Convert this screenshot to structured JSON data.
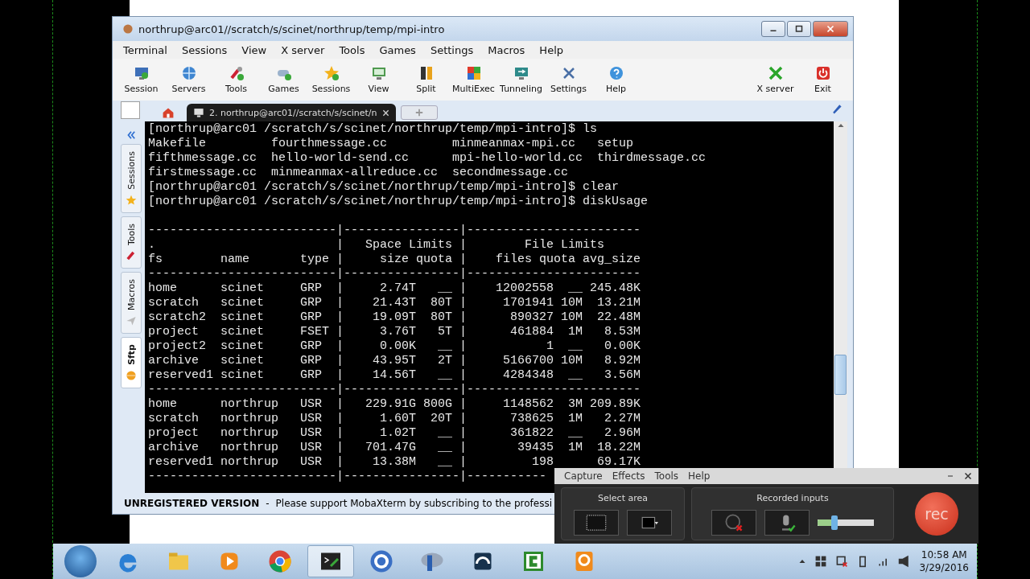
{
  "window": {
    "title": "northrup@arc01//scratch/s/scinet/northrup/temp/mpi-intro"
  },
  "menu": [
    "Terminal",
    "Sessions",
    "View",
    "X server",
    "Tools",
    "Games",
    "Settings",
    "Macros",
    "Help"
  ],
  "toolbar": {
    "left": [
      {
        "label": "Session"
      },
      {
        "label": "Servers"
      },
      {
        "label": "Tools"
      },
      {
        "label": "Games"
      },
      {
        "label": "Sessions"
      },
      {
        "label": "View"
      },
      {
        "label": "Split"
      },
      {
        "label": "MultiExec"
      },
      {
        "label": "Tunneling"
      },
      {
        "label": "Settings"
      },
      {
        "label": "Help"
      }
    ],
    "right": [
      {
        "label": "X server"
      },
      {
        "label": "Exit"
      }
    ]
  },
  "tabs": [
    {
      "kind": "home",
      "selected": false
    },
    {
      "kind": "session",
      "label": "2. northrup@arc01//scratch/s/scinet/n",
      "selected": true
    }
  ],
  "side_tabs": [
    {
      "label": "Sessions",
      "selected": false
    },
    {
      "label": "Tools",
      "selected": false
    },
    {
      "label": "Macros",
      "selected": false
    },
    {
      "label": "Sftp",
      "selected": true
    }
  ],
  "terminal": {
    "lines": [
      "[northrup@arc01 /scratch/s/scinet/northrup/temp/mpi-intro]$ ls",
      "Makefile         fourthmessage.cc         minmeanmax-mpi.cc   setup",
      "fifthmessage.cc  hello-world-send.cc      mpi-hello-world.cc  thirdmessage.cc",
      "firstmessage.cc  minmeanmax-allreduce.cc  secondmessage.cc",
      "[northrup@arc01 /scratch/s/scinet/northrup/temp/mpi-intro]$ clear",
      "[northrup@arc01 /scratch/s/scinet/northrup/temp/mpi-intro]$ diskUsage"
    ],
    "table_lines": [
      "--------------------------|----------------|------------------------",
      ".                         |   Space Limits |        File Limits",
      "fs        name       type |     size quota |    files quota avg_size",
      "--------------------------|----------------|------------------------",
      "home      scinet     GRP  |     2.74T   __ |    12002558  __ 245.48K",
      "scratch   scinet     GRP  |    21.43T  80T |     1701941 10M  13.21M",
      "scratch2  scinet     GRP  |    19.09T  80T |      890327 10M  22.48M",
      "project   scinet     FSET |     3.76T   5T |      461884  1M   8.53M",
      "project2  scinet     GRP  |     0.00K   __ |           1  __   0.00K",
      "archive   scinet     GRP  |    43.95T   2T |     5166700 10M   8.92M",
      "reserved1 scinet     GRP  |    14.56T   __ |     4284348  __   3.56M",
      "--------------------------|----------------|------------------------",
      "home      northrup   USR  |   229.91G 800G |     1148562  3M 209.89K",
      "scratch   northrup   USR  |     1.60T  20T |      738625  1M   2.27M",
      "project   northrup   USR  |     1.02T   __ |      361822  __   2.96M",
      "archive   northrup   USR  |   701.47G   __ |       39435  1M  18.22M",
      "reserved1 northrup   USR  |    13.38M   __ |         198      69.17K",
      "--------------------------|----------------|-----------"
    ]
  },
  "status_bar": {
    "title": "UNREGISTERED VERSION",
    "separator": "-",
    "message": "Please support MobaXterm by subscribing to the professi"
  },
  "recorder": {
    "menu": [
      "Capture",
      "Effects",
      "Tools",
      "Help"
    ],
    "select_area": {
      "title": "Select area"
    },
    "recorded_inputs": {
      "title": "Recorded inputs",
      "camera_on": false,
      "microphone_on": true,
      "volume": {
        "level": 0.3
      }
    },
    "rec_button": "rec"
  },
  "taskbar": {
    "apps": [
      {
        "selected": false
      },
      {
        "selected": false
      },
      {
        "selected": false
      },
      {
        "selected": false
      },
      {
        "selected": true
      },
      {
        "selected": false
      },
      {
        "selected": false
      },
      {
        "selected": false
      },
      {
        "selected": false
      },
      {
        "selected": false
      }
    ],
    "clock": {
      "time": "10:58 AM",
      "date": "3/29/2016"
    }
  }
}
